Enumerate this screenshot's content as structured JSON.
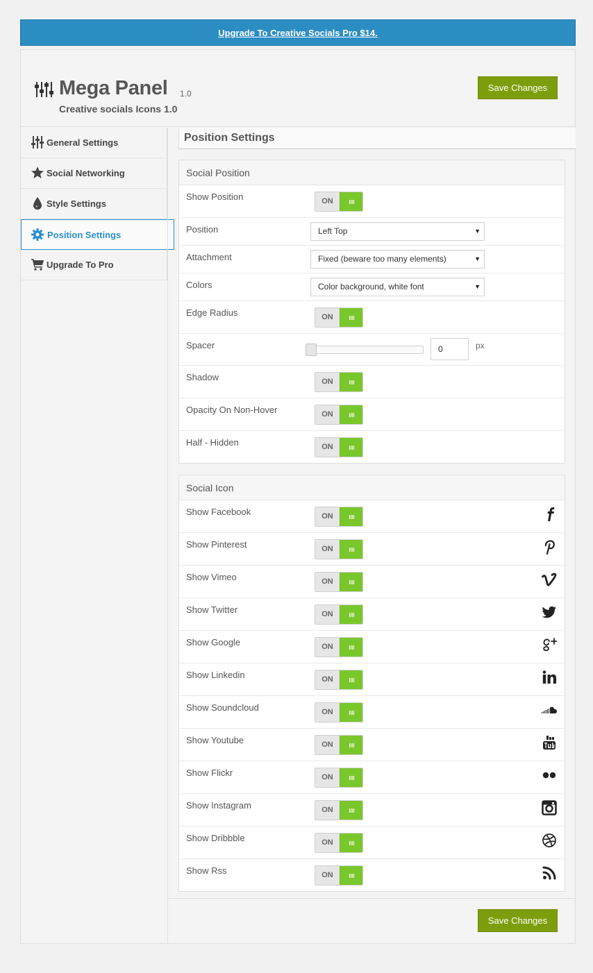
{
  "banner": {
    "text": "Upgrade To Creative Socials Pro $14."
  },
  "header": {
    "title": "Mega Panel",
    "version": "1.0",
    "subtitle": "Creative socials Icons 1.0",
    "save_label": "Save Changes"
  },
  "sidebar": {
    "items": [
      {
        "label": "General Settings",
        "icon": "sliders-icon",
        "active": false
      },
      {
        "label": "Social Networking",
        "icon": "star-icon",
        "active": false
      },
      {
        "label": "Style Settings",
        "icon": "drop-icon",
        "active": false
      },
      {
        "label": "Position Settings",
        "icon": "gear-icon",
        "active": true
      },
      {
        "label": "Upgrade To Pro",
        "icon": "cart-icon",
        "active": false
      }
    ]
  },
  "content": {
    "title": "Position Settings",
    "social_position": {
      "heading": "Social Position",
      "toggle_on_label": "ON",
      "show_position": {
        "label": "Show Position",
        "value": "ON"
      },
      "position": {
        "label": "Position",
        "value": "Left Top"
      },
      "attachment": {
        "label": "Attachment",
        "value": "Fixed (beware too many elements)"
      },
      "colors": {
        "label": "Colors",
        "value": "Color background, white font"
      },
      "edge_radius": {
        "label": "Edge Radius",
        "value": "ON"
      },
      "spacer": {
        "label": "Spacer",
        "value": "0",
        "unit": "px",
        "slider_fraction": 0
      },
      "shadow": {
        "label": "Shadow",
        "value": "ON"
      },
      "opacity": {
        "label": "Opacity On Non-Hover",
        "value": "ON"
      },
      "half_hidden": {
        "label": "Half - Hidden",
        "value": "ON"
      }
    },
    "social_icon": {
      "heading": "Social Icon",
      "toggle_on_label": "ON",
      "items": [
        {
          "label": "Show Facebook",
          "icon": "facebook-icon",
          "value": "ON"
        },
        {
          "label": "Show Pinterest",
          "icon": "pinterest-icon",
          "value": "ON"
        },
        {
          "label": "Show Vimeo",
          "icon": "vimeo-icon",
          "value": "ON"
        },
        {
          "label": "Show Twitter",
          "icon": "twitter-icon",
          "value": "ON"
        },
        {
          "label": "Show Google",
          "icon": "google-plus-icon",
          "value": "ON"
        },
        {
          "label": "Show Linkedin",
          "icon": "linkedin-icon",
          "value": "ON"
        },
        {
          "label": "Show Soundcloud",
          "icon": "soundcloud-icon",
          "value": "ON"
        },
        {
          "label": "Show Youtube",
          "icon": "youtube-icon",
          "value": "ON"
        },
        {
          "label": "Show Flickr",
          "icon": "flickr-icon",
          "value": "ON"
        },
        {
          "label": "Show Instagram",
          "icon": "instagram-icon",
          "value": "ON"
        },
        {
          "label": "Show Dribbble",
          "icon": "dribbble-icon",
          "value": "ON"
        },
        {
          "label": "Show Rss",
          "icon": "rss-icon",
          "value": "ON"
        }
      ]
    }
  },
  "colors": {
    "banner": "#2c8dc3",
    "save_button": "#7d9e0c",
    "toggle_on": "#7ac72c",
    "active_nav": "#2a8fcb"
  }
}
